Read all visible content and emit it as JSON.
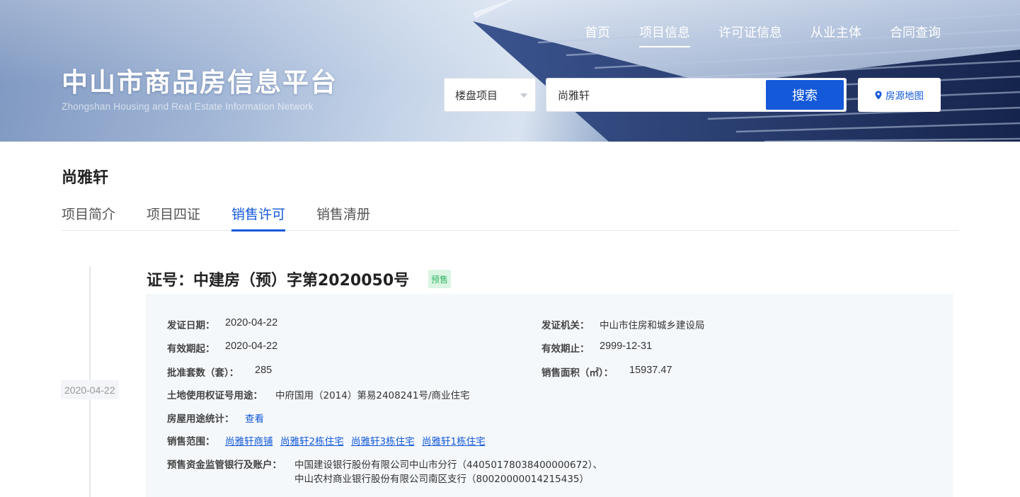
{
  "header": {
    "site_title": "中山市商品房信息平台",
    "site_subtitle": "Zhongshan Housing and Real Estate Information Network",
    "nav": [
      {
        "label": "首页",
        "active": false
      },
      {
        "label": "项目信息",
        "active": true
      },
      {
        "label": "许可证信息",
        "active": false
      },
      {
        "label": "从业主体",
        "active": false
      },
      {
        "label": "合同查询",
        "active": false
      }
    ],
    "search": {
      "category_selected": "楼盘项目",
      "query_value": "尚雅轩",
      "button_label": "搜索"
    },
    "map_button_label": "房源地图"
  },
  "project": {
    "title": "尚雅轩",
    "tabs": [
      {
        "label": "项目简介",
        "active": false
      },
      {
        "label": "项目四证",
        "active": false
      },
      {
        "label": "销售许可",
        "active": true
      },
      {
        "label": "销售清册",
        "active": false
      }
    ]
  },
  "permit": {
    "timeline_date": "2020-04-22",
    "number_label": "证号：中建房（预）字第2020050号",
    "status_badge": "预售",
    "fields": {
      "issue_date_label": "发证日期：",
      "issue_date": "2020-04-22",
      "issuer_label": "发证机关：",
      "issuer": "中山市住房和城乡建设局",
      "valid_from_label": "有效期起：",
      "valid_from": "2020-04-22",
      "valid_to_label": "有效期止：",
      "valid_to": "2999-12-31",
      "approved_units_label": "批准套数（套）：",
      "approved_units": "285",
      "sales_area_label": "销售面积（㎡）：",
      "sales_area": "15937.47",
      "land_cert_label": "土地使用权证号用途：",
      "land_cert": "中府国用（2014）第易2408241号/商业住宅",
      "usage_stats_label": "房屋用途统计：",
      "usage_stats_link": "查看",
      "sales_scope_label": "销售范围：",
      "sales_scope": [
        "尚雅轩商铺",
        "尚雅轩2栋住宅",
        "尚雅轩3栋住宅",
        "尚雅轩1栋住宅"
      ],
      "bank_label": "预售资金监管银行及账户：",
      "bank_accounts": [
        "中国建设银行股份有限公司中山市分行（44050178038400000672）、",
        "中山农村商业银行股份有限公司南区支行（80020000014215435）"
      ]
    }
  },
  "colors": {
    "accent": "#1459d9",
    "badge_bg": "#daf5e3",
    "badge_text": "#32b464",
    "card_bg": "#f5f8fb"
  }
}
